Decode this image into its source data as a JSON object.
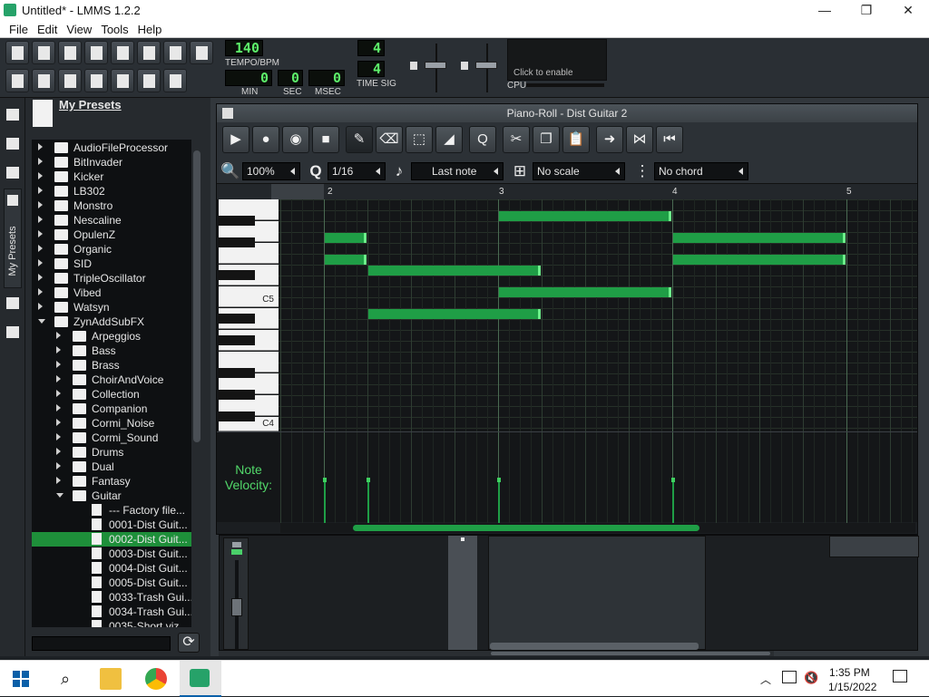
{
  "window": {
    "title": "Untitled* - LMMS 1.2.2",
    "minimize": "—",
    "maximize": "❐",
    "close": "✕"
  },
  "menu": [
    "File",
    "Edit",
    "View",
    "Tools",
    "Help"
  ],
  "toolbar": {
    "tempo_value": "140",
    "tempo_label": "TEMPO/BPM",
    "min_value": "0",
    "sec_value": "0",
    "msec_value": "0",
    "min_label": "MIN",
    "sec_label": "SEC",
    "msec_label": "MSEC",
    "timesig_num": "4",
    "timesig_den": "4",
    "timesig_label": "TIME SIG",
    "cpu_hint": "Click to enable",
    "cpu_label": "CPU"
  },
  "browser": {
    "header": "My Presets",
    "tab_label": "My Presets",
    "items": [
      {
        "label": "AudioFileProcessor",
        "depth": 0,
        "kind": "folder",
        "state": "closed"
      },
      {
        "label": "BitInvader",
        "depth": 0,
        "kind": "folder",
        "state": "closed"
      },
      {
        "label": "Kicker",
        "depth": 0,
        "kind": "folder",
        "state": "closed"
      },
      {
        "label": "LB302",
        "depth": 0,
        "kind": "folder",
        "state": "closed"
      },
      {
        "label": "Monstro",
        "depth": 0,
        "kind": "folder",
        "state": "closed"
      },
      {
        "label": "Nescaline",
        "depth": 0,
        "kind": "folder",
        "state": "closed"
      },
      {
        "label": "OpulenZ",
        "depth": 0,
        "kind": "folder",
        "state": "closed"
      },
      {
        "label": "Organic",
        "depth": 0,
        "kind": "folder",
        "state": "closed"
      },
      {
        "label": "SID",
        "depth": 0,
        "kind": "folder",
        "state": "closed"
      },
      {
        "label": "TripleOscillator",
        "depth": 0,
        "kind": "folder",
        "state": "closed"
      },
      {
        "label": "Vibed",
        "depth": 0,
        "kind": "folder",
        "state": "closed"
      },
      {
        "label": "Watsyn",
        "depth": 0,
        "kind": "folder",
        "state": "closed"
      },
      {
        "label": "ZynAddSubFX",
        "depth": 0,
        "kind": "folder",
        "state": "open"
      },
      {
        "label": "Arpeggios",
        "depth": 1,
        "kind": "folder",
        "state": "closed"
      },
      {
        "label": "Bass",
        "depth": 1,
        "kind": "folder",
        "state": "closed"
      },
      {
        "label": "Brass",
        "depth": 1,
        "kind": "folder",
        "state": "closed"
      },
      {
        "label": "ChoirAndVoice",
        "depth": 1,
        "kind": "folder",
        "state": "closed"
      },
      {
        "label": "Collection",
        "depth": 1,
        "kind": "folder",
        "state": "closed"
      },
      {
        "label": "Companion",
        "depth": 1,
        "kind": "folder",
        "state": "closed"
      },
      {
        "label": "Cormi_Noise",
        "depth": 1,
        "kind": "folder",
        "state": "closed"
      },
      {
        "label": "Cormi_Sound",
        "depth": 1,
        "kind": "folder",
        "state": "closed"
      },
      {
        "label": "Drums",
        "depth": 1,
        "kind": "folder",
        "state": "closed"
      },
      {
        "label": "Dual",
        "depth": 1,
        "kind": "folder",
        "state": "closed"
      },
      {
        "label": "Fantasy",
        "depth": 1,
        "kind": "folder",
        "state": "closed"
      },
      {
        "label": "Guitar",
        "depth": 1,
        "kind": "folder",
        "state": "open"
      },
      {
        "label": "--- Factory file...",
        "depth": 2,
        "kind": "preset",
        "state": ""
      },
      {
        "label": "0001-Dist Guit...",
        "depth": 2,
        "kind": "preset",
        "state": ""
      },
      {
        "label": "0002-Dist Guit...",
        "depth": 2,
        "kind": "preset",
        "state": "selected"
      },
      {
        "label": "0003-Dist Guit...",
        "depth": 2,
        "kind": "preset",
        "state": ""
      },
      {
        "label": "0004-Dist Guit...",
        "depth": 2,
        "kind": "preset",
        "state": ""
      },
      {
        "label": "0005-Dist Guit...",
        "depth": 2,
        "kind": "preset",
        "state": ""
      },
      {
        "label": "0033-Trash Gui...",
        "depth": 2,
        "kind": "preset",
        "state": ""
      },
      {
        "label": "0034-Trash Gui...",
        "depth": 2,
        "kind": "preset",
        "state": ""
      },
      {
        "label": "0035-Short viz...",
        "depth": 2,
        "kind": "preset",
        "state": ""
      }
    ]
  },
  "piano_roll": {
    "title": "Piano-Roll - Dist Guitar 2",
    "zoom": "100%",
    "quantize": "1/16",
    "note_length": "Last note",
    "scale": "No scale",
    "chord": "No chord",
    "bar_labels": [
      "2",
      "3",
      "4",
      "5"
    ],
    "key_labels": [
      "C5",
      "C4"
    ],
    "velocity_label_1": "Note",
    "velocity_label_2": "Velocity:",
    "accent_color": "#1f9e46",
    "notes": [
      {
        "bar": 2,
        "start_step": 0,
        "length_steps": 4,
        "pitch": "D5"
      },
      {
        "bar": 2,
        "start_step": 0,
        "length_steps": 4,
        "pitch": "C5"
      },
      {
        "bar": 2,
        "start_step": 4,
        "length_steps": 16,
        "pitch": "B4"
      },
      {
        "bar": 2,
        "start_step": 4,
        "length_steps": 16,
        "pitch": "G4"
      },
      {
        "bar": 3,
        "start_step": 0,
        "length_steps": 16,
        "pitch": "E5"
      },
      {
        "bar": 3,
        "start_step": 0,
        "length_steps": 16,
        "pitch": "A4"
      },
      {
        "bar": 4,
        "start_step": 0,
        "length_steps": 16,
        "pitch": "D5"
      },
      {
        "bar": 4,
        "start_step": 0,
        "length_steps": 16,
        "pitch": "C5"
      }
    ]
  },
  "taskbar": {
    "time": "1:35 PM",
    "date": "1/15/2022"
  }
}
